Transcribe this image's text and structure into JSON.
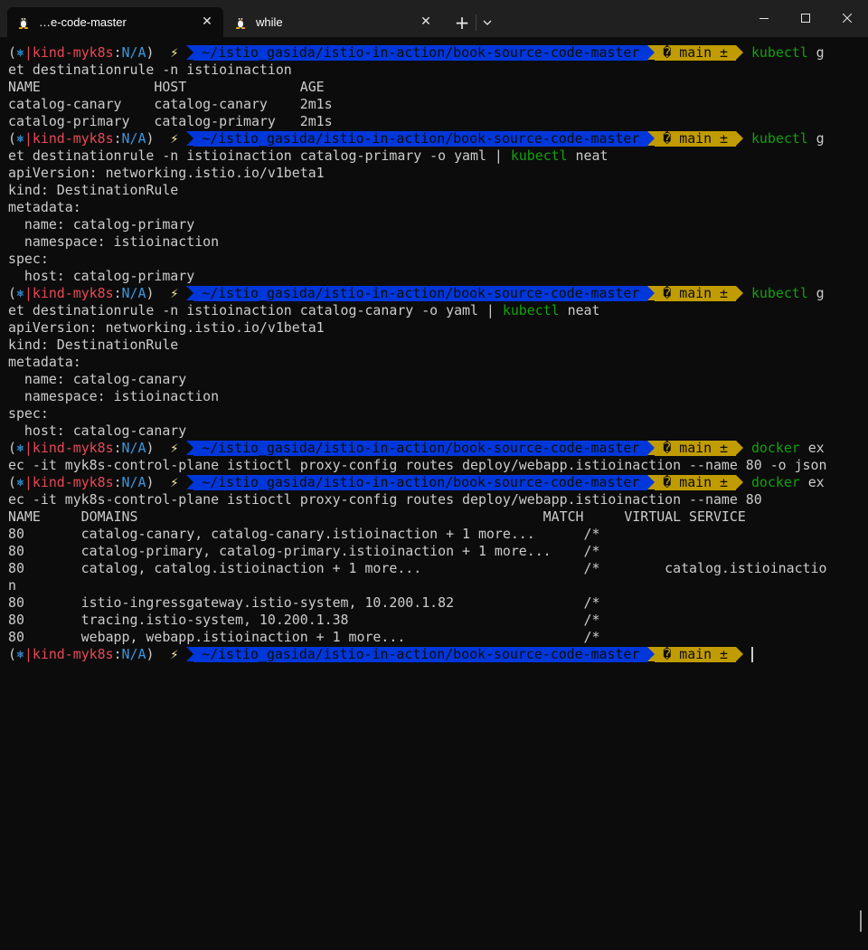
{
  "window": {
    "tabs": [
      {
        "label": "…e-code-master",
        "icon": "linux-penguin-icon",
        "active": true
      },
      {
        "label": "while",
        "icon": "linux-penguin-icon",
        "active": false
      }
    ],
    "new_tab_label": "+",
    "close_glyph": "✕"
  },
  "prompt": {
    "open_paren": "(",
    "k8s_icon": "⎈",
    "separator": "|",
    "cluster": "kind-myk8s",
    "colon": ":",
    "namespace": "N/A",
    "close_paren": ")",
    "bolt": "⚡",
    "path": "~/istio_gasida/istio-in-action/book-source-code-master",
    "git_branch": "� main ±"
  },
  "lines": [
    {
      "type": "prompt",
      "cmd": "kubectl",
      "rest": " g"
    },
    {
      "type": "text",
      "text": "et destinationrule -n istioinaction"
    },
    {
      "type": "text",
      "text": "NAME              HOST              AGE"
    },
    {
      "type": "text",
      "text": "catalog-canary    catalog-canary    2m1s"
    },
    {
      "type": "text",
      "text": "catalog-primary   catalog-primary   2m1s"
    },
    {
      "type": "prompt",
      "cmd": "kubectl",
      "rest": " g"
    },
    {
      "type": "pipe",
      "pre": "et destinationrule -n istioinaction catalog-primary -o yaml | ",
      "cmd": "kubectl",
      "post": " neat"
    },
    {
      "type": "text",
      "text": "apiVersion: networking.istio.io/v1beta1"
    },
    {
      "type": "text",
      "text": "kind: DestinationRule"
    },
    {
      "type": "text",
      "text": "metadata:"
    },
    {
      "type": "text",
      "text": "  name: catalog-primary"
    },
    {
      "type": "text",
      "text": "  namespace: istioinaction"
    },
    {
      "type": "text",
      "text": "spec:"
    },
    {
      "type": "text",
      "text": "  host: catalog-primary"
    },
    {
      "type": "prompt",
      "cmd": "kubectl",
      "rest": " g"
    },
    {
      "type": "pipe",
      "pre": "et destinationrule -n istioinaction catalog-canary -o yaml | ",
      "cmd": "kubectl",
      "post": " neat"
    },
    {
      "type": "text",
      "text": "apiVersion: networking.istio.io/v1beta1"
    },
    {
      "type": "text",
      "text": "kind: DestinationRule"
    },
    {
      "type": "text",
      "text": "metadata:"
    },
    {
      "type": "text",
      "text": "  name: catalog-canary"
    },
    {
      "type": "text",
      "text": "  namespace: istioinaction"
    },
    {
      "type": "text",
      "text": "spec:"
    },
    {
      "type": "text",
      "text": "  host: catalog-canary"
    },
    {
      "type": "prompt",
      "cmd": "docker",
      "rest": " ex"
    },
    {
      "type": "text",
      "text": "ec -it myk8s-control-plane istioctl proxy-config routes deploy/webapp.istioinaction --name 80 -o json"
    },
    {
      "type": "prompt",
      "cmd": "docker",
      "rest": " ex"
    },
    {
      "type": "text",
      "text": "ec -it myk8s-control-plane istioctl proxy-config routes deploy/webapp.istioinaction --name 80"
    },
    {
      "type": "text",
      "text": "NAME     DOMAINS                                                  MATCH     VIRTUAL SERVICE"
    },
    {
      "type": "text",
      "text": "80       catalog-canary, catalog-canary.istioinaction + 1 more...      /*"
    },
    {
      "type": "text",
      "text": "80       catalog-primary, catalog-primary.istioinaction + 1 more...    /*"
    },
    {
      "type": "text",
      "text": "80       catalog, catalog.istioinaction + 1 more...                    /*        catalog.istioinactio"
    },
    {
      "type": "text",
      "text": "n"
    },
    {
      "type": "text",
      "text": "80       istio-ingressgateway.istio-system, 10.200.1.82                /*"
    },
    {
      "type": "text",
      "text": "80       tracing.istio-system, 10.200.1.38                             /*"
    },
    {
      "type": "text",
      "text": "80       webapp, webapp.istioinaction + 1 more...                      /*"
    },
    {
      "type": "prompt",
      "cmd": "",
      "rest": "",
      "cursor": true
    }
  ],
  "colors": {
    "background": "#0c0c0c",
    "titlebar": "#202020",
    "cluster": "#e74856",
    "command": "#13a10e",
    "path_segment": "#0037da",
    "git_segment": "#c19c00"
  }
}
